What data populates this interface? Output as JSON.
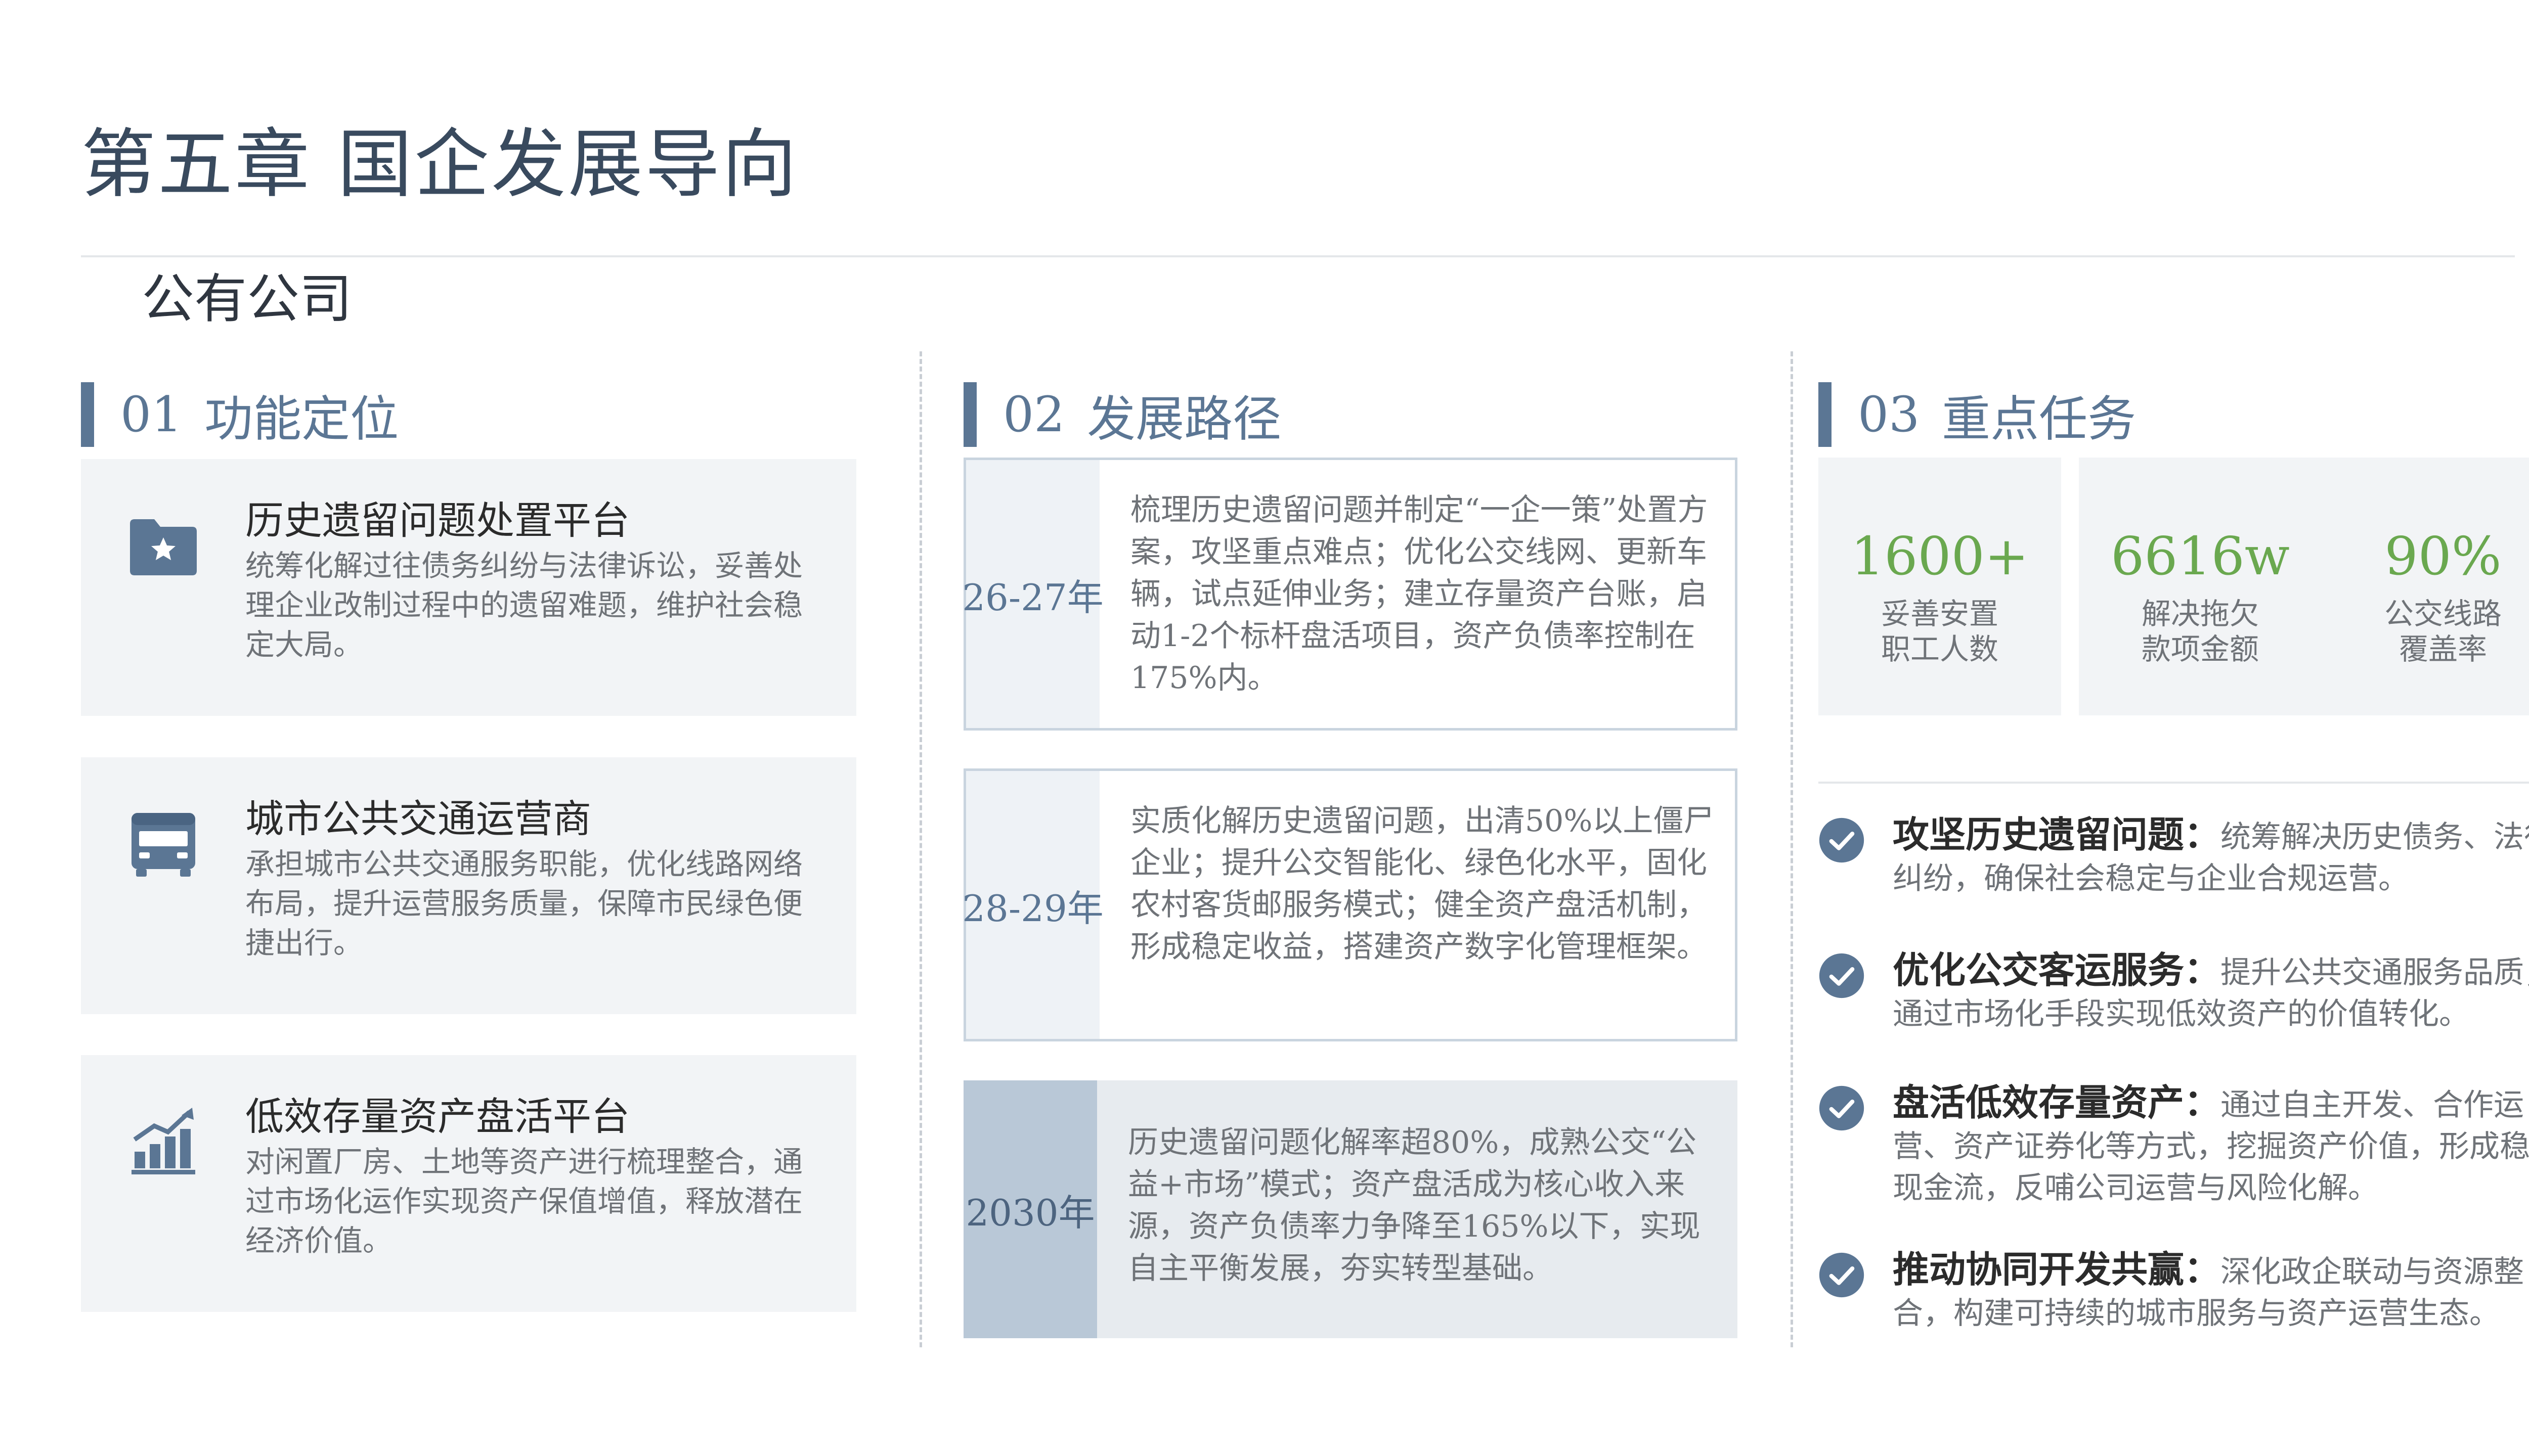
{
  "header": {
    "chapter_title": "第五章  国企发展导向",
    "company_name": "公有公司"
  },
  "sections": {
    "function": {
      "num": "01",
      "title": "功能定位"
    },
    "path": {
      "num": "02",
      "title": "发展路径"
    },
    "tasks": {
      "num": "03",
      "title": "重点任务"
    }
  },
  "functions": [
    {
      "icon": "folder-star-icon",
      "title": "历史遗留问题处置平台",
      "text": "统筹化解过往债务纠纷与法律诉讼，妥善处理企业改制过程中的遗留难题，维护社会稳定大局。"
    },
    {
      "icon": "bus-icon",
      "title": "城市公共交通运营商",
      "text": "承担城市公共交通服务职能，优化线路网络布局，提升运营服务质量，保障市民绿色便捷出行。"
    },
    {
      "icon": "bar-chart-trend-icon",
      "title": "低效存量资产盘活平台",
      "text": "对闲置厂房、土地等资产进行梳理整合，通过市场化运作实现资产保值增值，释放潜在经济价值。"
    }
  ],
  "path": [
    {
      "year": "26-27年",
      "text": "梳理历史遗留问题并制定“一企一策”处置方案，攻坚重点难点；优化公交线网、更新车辆，试点延伸业务；建立存量资产台账，启动1-2个标杆盘活项目，资产负债率控制在175%内。"
    },
    {
      "year": "28-29年",
      "text": "实质化解历史遗留问题，出清50%以上僵尸企业；提升公交智能化、绿色化水平，固化农村客货邮服务模式；健全资产盘活机制，形成稳定收益，搭建资产数字化管理框架。"
    },
    {
      "year": "2030年",
      "text": "历史遗留问题化解率超80%，成熟公交“公益+市场”模式；资产盘活成为核心收入来源，资产负债率力争降至165%以下，实现自主平衡发展，夯实转型基础。"
    }
  ],
  "stats": [
    {
      "value": "1600+",
      "label_line1": "妥善安置",
      "label_line2": "职工人数"
    },
    {
      "value": "6616w",
      "label_line1": "解决拖欠",
      "label_line2": "款项金额"
    },
    {
      "value": "90%",
      "label_line1": "公交线路",
      "label_line2": "覆盖率"
    }
  ],
  "tasks": [
    {
      "head": "攻坚历史遗留问题：",
      "text": "统筹解决历史债务、法律纠纷，确保社会稳定与企业合规运营。"
    },
    {
      "head": "优化公交客运服务：",
      "text": "提升公共交通服务品质，通过市场化手段实现低效资产的价值转化。"
    },
    {
      "head": "盘活低效存量资产：",
      "text": "通过自主开发、合作运营、资产证券化等方式，挖掘资产价值，形成稳定现金流，反哺公司运营与风险化解。"
    },
    {
      "head": "推动协同开发共赢：",
      "text": "深化政企联动与资源整合，构建可持续的城市服务与资产运营生态。"
    }
  ],
  "colors": {
    "accent": "#5b7694",
    "title": "#394a5e",
    "stat_green": "#6aa84f",
    "card_bg": "#f2f4f6",
    "body_text": "#6f7378"
  }
}
